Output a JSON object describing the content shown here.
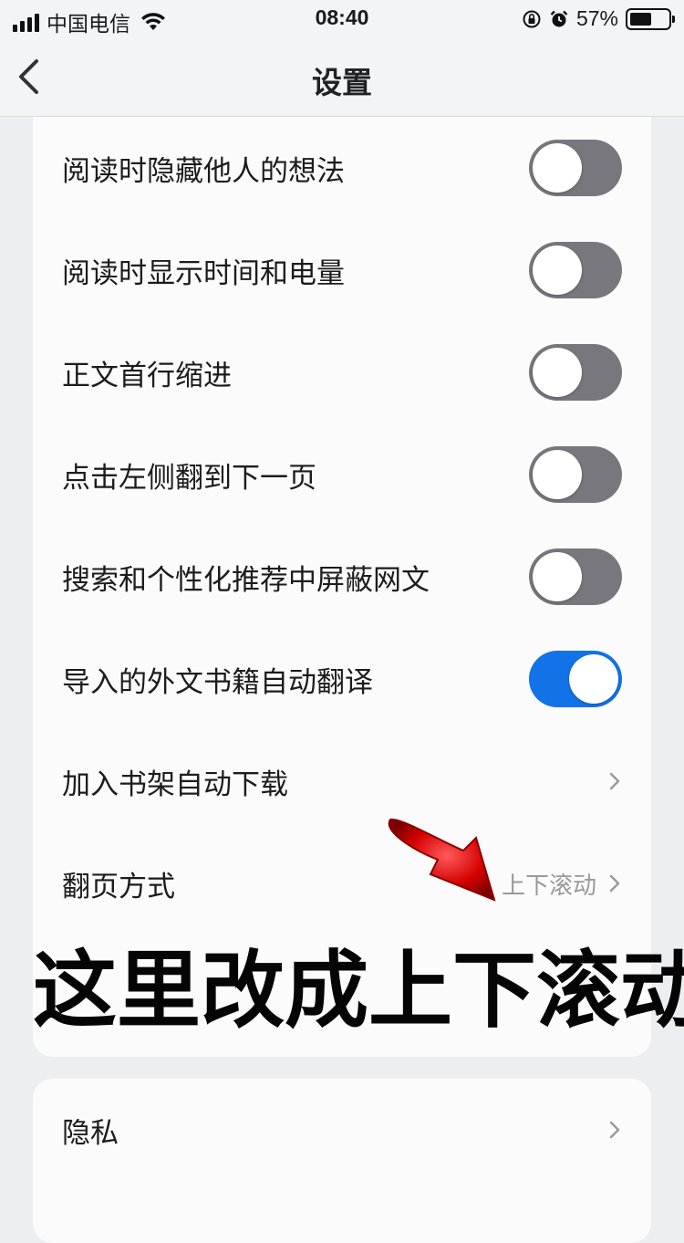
{
  "status_bar": {
    "carrier": "中国电信",
    "time": "08:40",
    "battery_percent": "57%",
    "battery_level": 0.57
  },
  "nav": {
    "title": "设置"
  },
  "settings": {
    "rows": [
      {
        "label": "阅读时隐藏他人的想法",
        "type": "toggle",
        "on": false
      },
      {
        "label": "阅读时显示时间和电量",
        "type": "toggle",
        "on": false
      },
      {
        "label": "正文首行缩进",
        "type": "toggle",
        "on": false
      },
      {
        "label": "点击左侧翻到下一页",
        "type": "toggle",
        "on": false
      },
      {
        "label": "搜索和个性化推荐中屏蔽网文",
        "type": "toggle",
        "on": false
      },
      {
        "label": "导入的外文书籍自动翻译",
        "type": "toggle",
        "on": true
      },
      {
        "label": "加入书架自动下载",
        "type": "link"
      },
      {
        "label": "翻页方式",
        "type": "link",
        "value": "上下滚动"
      }
    ]
  },
  "privacy": {
    "label": "隐私"
  },
  "overlay": {
    "caption": "这里改成上下滚动"
  },
  "colors": {
    "accent": "#1273e8",
    "toggle_off": "#77777d",
    "arrow": "#d40000"
  }
}
